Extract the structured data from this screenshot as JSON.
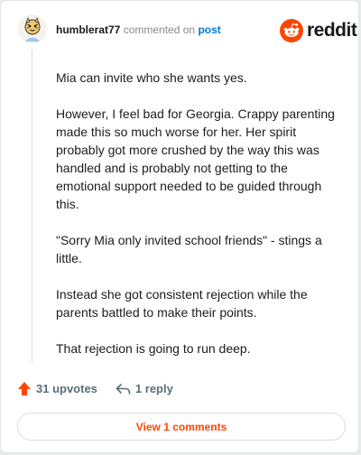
{
  "header": {
    "username": "humblerat77",
    "action_text": "commented on",
    "post_link": "post"
  },
  "brand": {
    "wordmark": "reddit",
    "icon": "reddit-logo-icon",
    "color": "#ff4500"
  },
  "comment": {
    "paragraphs": [
      "Mia can invite who she wants yes.",
      "However, I feel bad for Georgia. Crappy parenting made this so much worse for her. Her spirit probably got more crushed by the way this was handled and is probably not getting to the emotional support needed to be guided through this.",
      "\"Sorry Mia only invited school friends\" - stings a little.",
      "Instead she got consistent rejection while the parents battled to make their points.",
      "That rejection is going to run deep."
    ]
  },
  "actions": {
    "upvotes_label": "31 upvotes",
    "upvote_icon": "upvote-arrow-icon",
    "reply_label": "1 reply",
    "reply_icon": "reply-arrow-icon"
  },
  "footer": {
    "view_comments_label": "View 1 comments"
  }
}
